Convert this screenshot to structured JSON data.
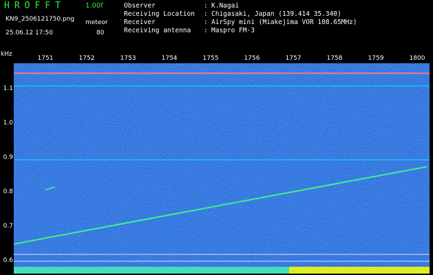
{
  "header": {
    "title": "HROFFT",
    "version": "1.00f",
    "filename": "KN9_2506121750.png",
    "mode": "meteor",
    "datetime": "25.06.12 17:50",
    "count": "80"
  },
  "info": [
    {
      "label": "Observer",
      "value": "K.Nagai"
    },
    {
      "label": "Receiving Location",
      "value": "Chigasaki, Japan (139.414 35.340)"
    },
    {
      "label": "Receiver",
      "value": "AirSpy mini (Miakejima VOR 108.65MHz)"
    },
    {
      "label": "Receiving antenna",
      "value": "Maspro FM-3"
    }
  ],
  "chart_data": {
    "type": "heatmap",
    "ylabel": "kHz",
    "x_ticks": [
      "1751",
      "1752",
      "1753",
      "1754",
      "1755",
      "1756",
      "1757",
      "1758",
      "1759",
      "1800"
    ],
    "y_ticks": [
      "1.1",
      "1.0",
      "0.9",
      "0.8",
      "0.7",
      "0.6"
    ],
    "ylim": [
      0.6,
      1.15
    ],
    "horizontal_lines_khz": [
      1.147,
      1.11,
      0.895,
      0.62,
      0.6
    ],
    "diagonal_trace": {
      "start": {
        "time": "1750",
        "khz": 0.65
      },
      "end": {
        "time": "1800",
        "khz": 0.875
      }
    },
    "colors": {
      "background": "#000000",
      "noise": "#1a1aa0",
      "signal": "#00ffff",
      "header_text": "#33ee33",
      "bottom_bar": "#ffff00"
    }
  }
}
